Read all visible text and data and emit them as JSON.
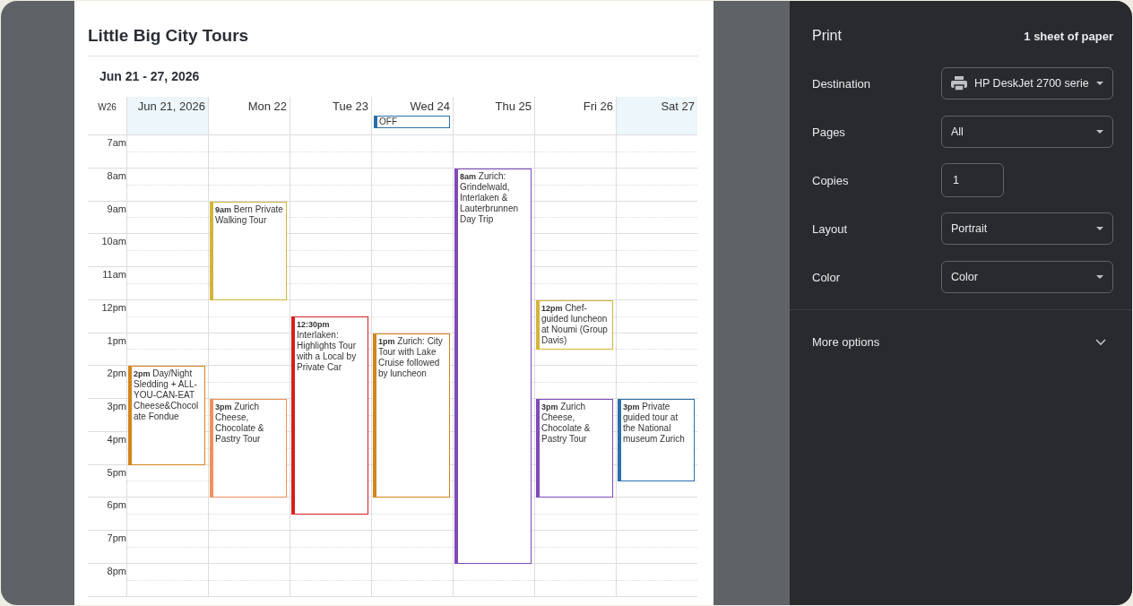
{
  "preview": {
    "title": "Little Big City Tours",
    "range": "Jun 21 - 27, 2026",
    "week": "W26",
    "hours": [
      "7am",
      "8am",
      "9am",
      "10am",
      "11am",
      "12pm",
      "1pm",
      "2pm",
      "3pm",
      "4pm",
      "5pm",
      "6pm",
      "7pm",
      "8pm"
    ],
    "days": [
      {
        "label": "Jun 21, 2026",
        "weekend": true,
        "events": [
          {
            "time": "2pm",
            "title": "Day/Night Sledding + ALL-YOU-CAN-EAT Cheese&Chocolate Fondue",
            "kind": "standard",
            "color": "#d4841c"
          }
        ]
      },
      {
        "label": "Mon 22",
        "weekend": false,
        "events": [
          {
            "time": "9am",
            "title": "Bern Private Walking Tour",
            "kind": "standard",
            "color": "#d4b43a"
          },
          {
            "time": "3pm",
            "title": "Zurich Cheese, Chocolate & Pastry Tour",
            "kind": "standard",
            "color": "#f0905a"
          }
        ]
      },
      {
        "label": "Tue 23",
        "weekend": false,
        "events": [
          {
            "time": "12:30pm",
            "title": "Interlaken: Highlights Tour with a Local by Private Car",
            "kind": "extended",
            "color": "#d42020"
          }
        ]
      },
      {
        "label": "Wed 24",
        "weekend": false,
        "all_day": [
          {
            "title": "OFF",
            "color": "#2a6fa8"
          }
        ],
        "events": [
          {
            "time": "1pm",
            "title": "Zurich: City Tour with Lake Cruise followed by luncheon",
            "kind": "long",
            "color": "#d4841c"
          }
        ]
      },
      {
        "label": "Thu 25",
        "weekend": false,
        "events": [
          {
            "time": "8am",
            "title": "Zurich: Grindelwald, Interlaken & Lauterbrunnen Day Trip",
            "kind": "fullday",
            "color": "#7e4ab8"
          }
        ]
      },
      {
        "label": "Fri 26",
        "weekend": false,
        "events": [
          {
            "time": "12pm",
            "title": "Chef-guided luncheon at Noumi (Group Davis)",
            "kind": "short",
            "color": "#d4b43a"
          },
          {
            "time": "3pm",
            "title": "Zurich Cheese, Chocolate & Pastry Tour",
            "kind": "standard",
            "color": "#7e4ab8"
          }
        ]
      },
      {
        "label": "Sat 27",
        "weekend": true,
        "events": [
          {
            "time": "3pm",
            "title": "Private guided tour at the National museum Zurich",
            "kind": "medium",
            "color": "#2a6fa8"
          }
        ]
      }
    ]
  },
  "print": {
    "title": "Print",
    "sheets": "1 sheet of paper",
    "settings": [
      {
        "label": "Destination",
        "kind": "select",
        "value": "HP DeskJet 2700 serie",
        "icon": true
      },
      {
        "label": "Pages",
        "kind": "select",
        "value": "All",
        "icon": false
      },
      {
        "label": "Copies",
        "kind": "input",
        "value": "1"
      },
      {
        "label": "Layout",
        "kind": "select",
        "value": "Portrait",
        "icon": false
      },
      {
        "label": "Color",
        "kind": "select",
        "value": "Color",
        "icon": false
      }
    ],
    "more": {
      "label": "More options",
      "expanded": false
    }
  }
}
